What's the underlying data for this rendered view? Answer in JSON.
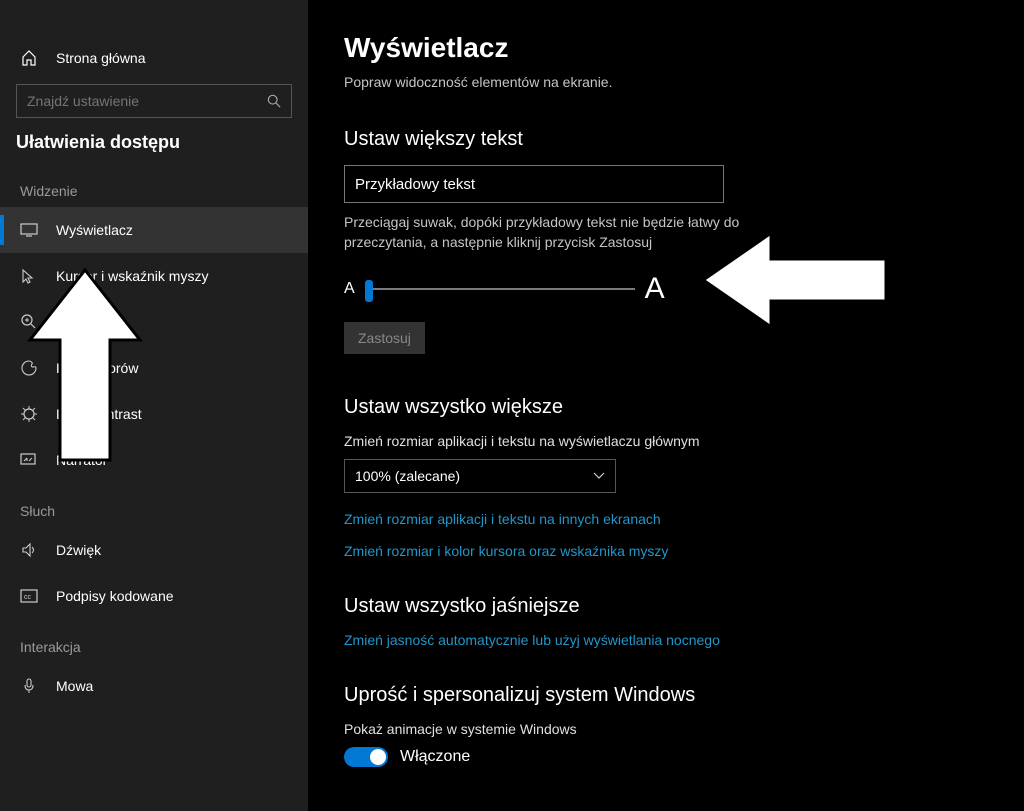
{
  "sidebar": {
    "home": "Strona główna",
    "search_placeholder": "Znajdź ustawienie",
    "section_title": "Ułatwienia dostępu",
    "groups": {
      "vision": "Widzenie",
      "hearing": "Słuch",
      "interaction": "Interakcja"
    },
    "items": {
      "display": "Wyświetlacz",
      "cursor": "Kursor i wskaźnik myszy",
      "magnifier": "Lupa",
      "color_filters": "Filtry kolorów",
      "high_contrast": "Duży kontrast",
      "narrator": "Narrator",
      "sound": "Dźwięk",
      "closed_captions": "Podpisy kodowane",
      "speech": "Mowa"
    }
  },
  "main": {
    "title": "Wyświetlacz",
    "subtitle": "Popraw widoczność elementów na ekranie.",
    "bigger_text": {
      "heading": "Ustaw większy tekst",
      "sample": "Przykładowy tekst",
      "desc": "Przeciągaj suwak, dopóki przykładowy tekst nie będzie łatwy do przeczytania, a następnie kliknij przycisk Zastosuj",
      "small_a": "A",
      "big_a": "A",
      "apply": "Zastosuj"
    },
    "everything_bigger": {
      "heading": "Ustaw wszystko większe",
      "label": "Zmień rozmiar aplikacji i tekstu na wyświetlaczu głównym",
      "dropdown_value": "100% (zalecane)",
      "link1": "Zmień rozmiar aplikacji i tekstu na innych ekranach",
      "link2": "Zmień rozmiar i kolor kursora oraz wskaźnika myszy"
    },
    "brighter": {
      "heading": "Ustaw wszystko jaśniejsze",
      "link": "Zmień jasność automatycznie lub użyj wyświetlania nocnego"
    },
    "simplify": {
      "heading": "Uprość i spersonalizuj system Windows",
      "animations_label": "Pokaż animacje w systemie Windows",
      "toggle_label": "Włączone"
    }
  }
}
